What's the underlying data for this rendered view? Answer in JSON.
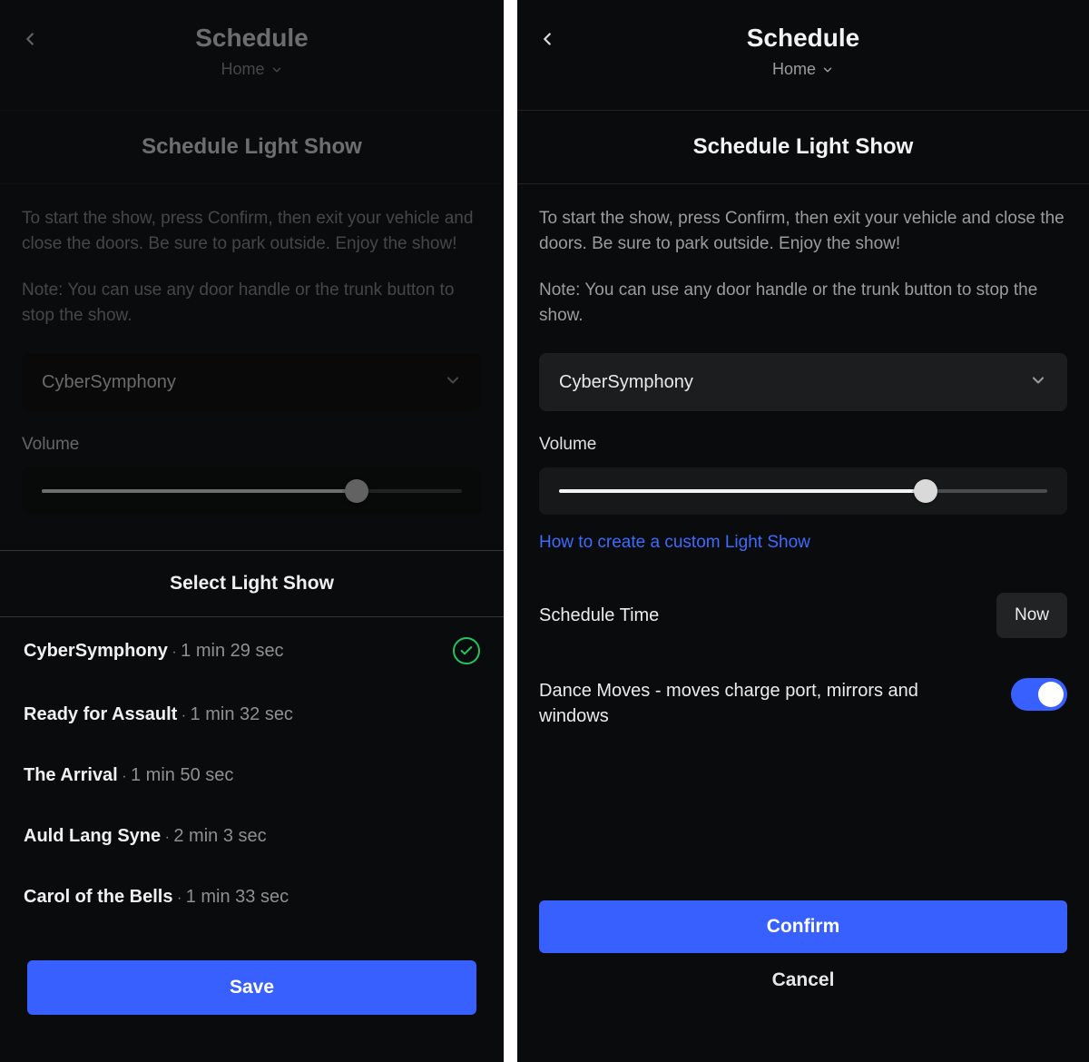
{
  "header": {
    "title": "Schedule",
    "location": "Home"
  },
  "section_title": "Schedule Light Show",
  "instructions": {
    "p1": "To start the show, press Confirm, then exit your vehicle and close the doors. Be sure to park outside. Enjoy the show!",
    "p2": "Note: You can use any door handle or the trunk button to stop the show."
  },
  "dropdown": {
    "selected": "CyberSymphony"
  },
  "volume": {
    "label": "Volume",
    "percent": 75
  },
  "custom_link": "How to create a custom Light Show",
  "schedule_time": {
    "label": "Schedule Time",
    "value": "Now"
  },
  "dance_moves": {
    "label": "Dance Moves - moves charge port, mirrors and windows",
    "enabled": true
  },
  "buttons": {
    "confirm": "Confirm",
    "cancel": "Cancel",
    "save": "Save"
  },
  "sheet": {
    "title": "Select Light Show",
    "items": [
      {
        "name": "CyberSymphony",
        "duration": "1 min 29 sec",
        "selected": true
      },
      {
        "name": "Ready for Assault",
        "duration": "1 min 32 sec",
        "selected": false
      },
      {
        "name": "The Arrival",
        "duration": "1 min 50 sec",
        "selected": false
      },
      {
        "name": "Auld Lang Syne",
        "duration": "2 min 3 sec",
        "selected": false
      },
      {
        "name": "Carol of the Bells",
        "duration": "1 min 33 sec",
        "selected": false
      }
    ]
  },
  "colors": {
    "accent": "#3860ff",
    "success": "#22c55e"
  }
}
